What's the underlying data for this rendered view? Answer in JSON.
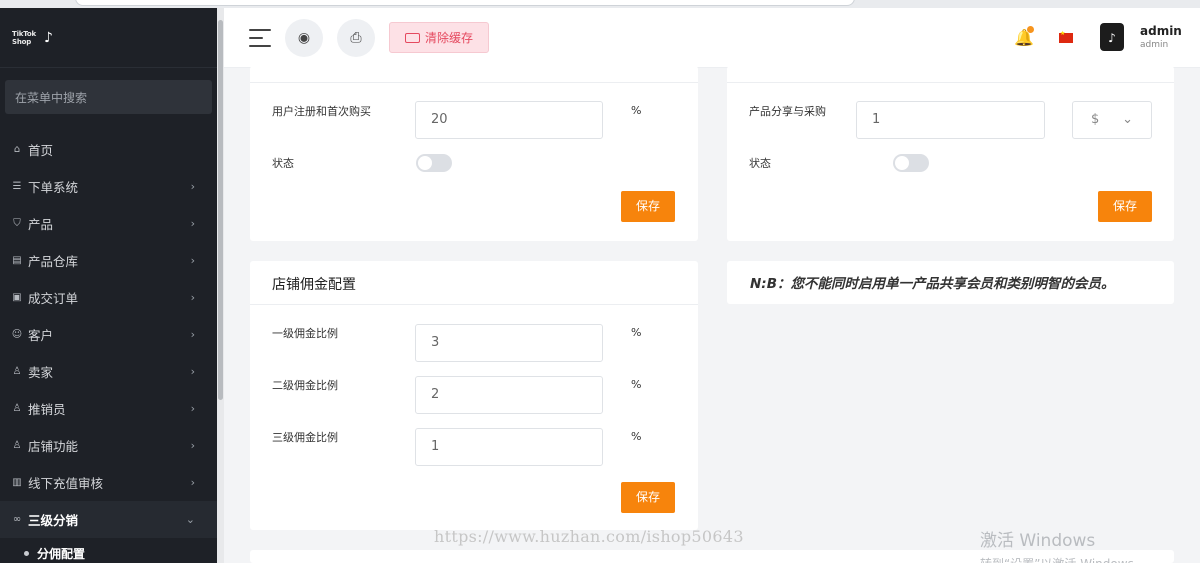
{
  "brand": {
    "logo_text_1": "TikTok",
    "logo_text_2": "Shop",
    "logo_glyph": "♪"
  },
  "sidebar": {
    "search_placeholder": "在菜单中搜索",
    "items": [
      {
        "label": "首页",
        "icon": "home-icon",
        "glyph": "⌂",
        "has_children": false
      },
      {
        "label": "下单系统",
        "icon": "list-icon",
        "glyph": "☰",
        "has_children": true
      },
      {
        "label": "产品",
        "icon": "cart-icon",
        "glyph": "⛉",
        "has_children": true
      },
      {
        "label": "产品仓库",
        "icon": "warehouse-icon",
        "glyph": "▤",
        "has_children": true
      },
      {
        "label": "成交订单",
        "icon": "ticket-icon",
        "glyph": "▣",
        "has_children": true
      },
      {
        "label": "客户",
        "icon": "users-icon",
        "glyph": "☺",
        "has_children": true
      },
      {
        "label": "卖家",
        "icon": "user-icon",
        "glyph": "♙",
        "has_children": true
      },
      {
        "label": "推销员",
        "icon": "user-icon",
        "glyph": "♙",
        "has_children": true
      },
      {
        "label": "店铺功能",
        "icon": "user-icon",
        "glyph": "♙",
        "has_children": true
      },
      {
        "label": "线下充值审核",
        "icon": "card-icon",
        "glyph": "▥",
        "has_children": true
      },
      {
        "label": "三级分销",
        "icon": "link-icon",
        "glyph": "∞",
        "has_children": true,
        "expanded": true
      }
    ],
    "sub_items": [
      {
        "label": "分佣配置"
      }
    ],
    "chevron_right": "›",
    "chevron_down": "⌄"
  },
  "header": {
    "globe_glyph": "◉",
    "print_glyph": "⎙",
    "clear_cache_label": "清除缓存",
    "bell_glyph": "🔔",
    "avatar_glyph": "♪",
    "user_name": "admin",
    "user_role": "admin"
  },
  "card_signup": {
    "label": "用户注册和首次购买",
    "value": "20",
    "unit": "%",
    "status_label": "状态",
    "status_on": false,
    "save_label": "保存"
  },
  "card_share": {
    "label": "产品分享与采购",
    "value": "1",
    "currency": "$",
    "currency_chevron": "⌄",
    "status_label": "状态",
    "status_on": false,
    "save_label": "保存"
  },
  "card_commission": {
    "title": "店铺佣金配置",
    "rows": [
      {
        "label": "一级佣金比例",
        "value": "3",
        "unit": "%"
      },
      {
        "label": "二级佣金比例",
        "value": "2",
        "unit": "%"
      },
      {
        "label": "三级佣金比例",
        "value": "1",
        "unit": "%"
      }
    ],
    "save_label": "保存"
  },
  "note": {
    "text": "N:B：您不能同时启用单一产品共享会员和类别明智的会员。"
  },
  "overlay": {
    "watermark": "https://www.huzhan.com/ishop50643",
    "windows_title": "激活 Windows",
    "windows_sub": "转到“设置”以激活 Windows。"
  }
}
